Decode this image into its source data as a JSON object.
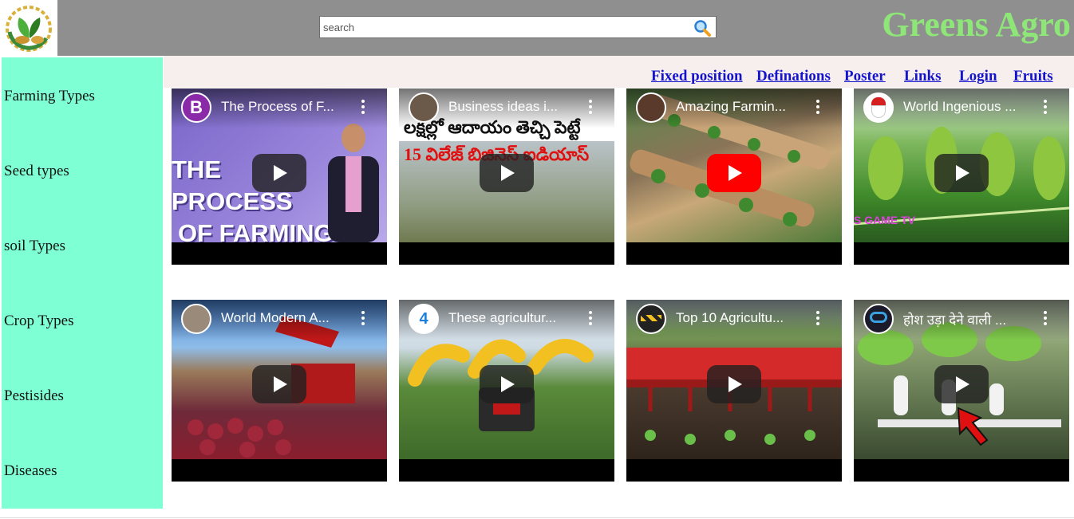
{
  "header": {
    "brand": "Greens Agro",
    "search_placeholder": "search",
    "search_icon": "magnifier-icon",
    "logo_icon": "leaf-logo-icon",
    "background": "#8f8f8f",
    "brand_color": "#8ee678"
  },
  "sidebar": {
    "background": "#7fffd4",
    "items": [
      {
        "label": "Farming Types"
      },
      {
        "label": "Seed types"
      },
      {
        "label": "soil Types"
      },
      {
        "label": "Crop Types"
      },
      {
        "label": "Pestisides"
      },
      {
        "label": "Diseases"
      }
    ]
  },
  "nav": {
    "background": "#f7eeee",
    "link_color": "#1414cc",
    "links": [
      {
        "label": "Fixed position"
      },
      {
        "label": "Definations"
      },
      {
        "label": "Poster"
      },
      {
        "label": "Links"
      },
      {
        "label": "Login"
      },
      {
        "label": "Fruits"
      }
    ]
  },
  "videos": [
    {
      "title": "The Process of F...",
      "thumb_text": [
        "THE PROCESS",
        "OF FARMING"
      ]
    },
    {
      "title": "Business ideas i...",
      "thumb_text": [
        "లక్షల్లో ఆదాయం తెచ్చి పెట్టే",
        "15 విలేజ్ బిజినెస్ ఐడియాస్"
      ]
    },
    {
      "title": "Amazing Farmin..."
    },
    {
      "title": "World Ingenious ...",
      "thumb_text": [
        "S GAME TV"
      ]
    },
    {
      "title": "World Modern A..."
    },
    {
      "title": "These agricultur..."
    },
    {
      "title": "Top 10 Agricultu..."
    },
    {
      "title": "होश उड़ा देने वाली ..."
    }
  ]
}
